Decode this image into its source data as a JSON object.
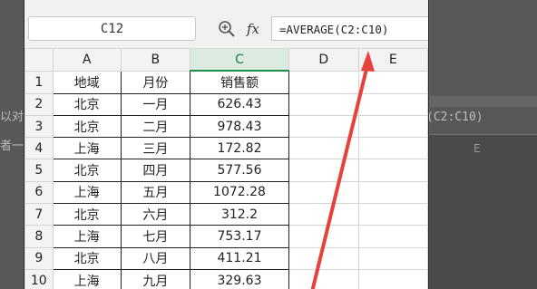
{
  "background": {
    "fragment_1": "以对",
    "fragment_2": "者一",
    "fragment_3": "(C2:C10)",
    "fragment_4": "E"
  },
  "formula_bar": {
    "name_box": "C12",
    "fx_label": "fx",
    "formula": "=AVERAGE(C2:C10)"
  },
  "columns": [
    "A",
    "B",
    "C",
    "D",
    "E"
  ],
  "selected_column": "C",
  "rows": [
    {
      "n": "1",
      "a": "地域",
      "b": "月份",
      "c": "销售额"
    },
    {
      "n": "2",
      "a": "北京",
      "b": "一月",
      "c": "626.43"
    },
    {
      "n": "3",
      "a": "北京",
      "b": "二月",
      "c": "978.43"
    },
    {
      "n": "4",
      "a": "上海",
      "b": "三月",
      "c": "172.82"
    },
    {
      "n": "5",
      "a": "北京",
      "b": "四月",
      "c": "577.56"
    },
    {
      "n": "6",
      "a": "上海",
      "b": "五月",
      "c": "1072.28"
    },
    {
      "n": "7",
      "a": "北京",
      "b": "六月",
      "c": "312.2"
    },
    {
      "n": "8",
      "a": "上海",
      "b": "七月",
      "c": "753.17"
    },
    {
      "n": "9",
      "a": "北京",
      "b": "八月",
      "c": "411.21"
    },
    {
      "n": "10",
      "a": "上海",
      "b": "九月",
      "c": "329.63"
    }
  ],
  "colors": {
    "arrow": "#e8403a",
    "selected_header": "#dcebe0"
  }
}
